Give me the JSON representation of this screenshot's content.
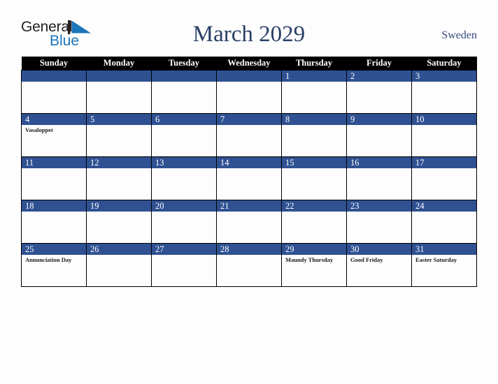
{
  "brand": {
    "name_part1": "General",
    "name_part2": "Blue",
    "mark_icon": "triangle-flag-icon",
    "color_dark": "#231f20",
    "color_blue": "#1b75bb"
  },
  "header": {
    "title": "March 2029",
    "country": "Sweden"
  },
  "colors": {
    "header_row_bg": "#000000",
    "day_band_bg": "#2f5192",
    "title_text": "#2b3f66",
    "country_text": "#34497a",
    "page_bg": "#fdfdfd",
    "grid_border": "#000000"
  },
  "calendar": {
    "weekday_headers": [
      "Sunday",
      "Monday",
      "Tuesday",
      "Wednesday",
      "Thursday",
      "Friday",
      "Saturday"
    ],
    "weeks": [
      [
        {
          "date": "",
          "events": []
        },
        {
          "date": "",
          "events": []
        },
        {
          "date": "",
          "events": []
        },
        {
          "date": "",
          "events": []
        },
        {
          "date": "1",
          "events": []
        },
        {
          "date": "2",
          "events": []
        },
        {
          "date": "3",
          "events": []
        }
      ],
      [
        {
          "date": "4",
          "events": [
            "Vasaloppet"
          ]
        },
        {
          "date": "5",
          "events": []
        },
        {
          "date": "6",
          "events": []
        },
        {
          "date": "7",
          "events": []
        },
        {
          "date": "8",
          "events": []
        },
        {
          "date": "9",
          "events": []
        },
        {
          "date": "10",
          "events": []
        }
      ],
      [
        {
          "date": "11",
          "events": []
        },
        {
          "date": "12",
          "events": []
        },
        {
          "date": "13",
          "events": []
        },
        {
          "date": "14",
          "events": []
        },
        {
          "date": "15",
          "events": []
        },
        {
          "date": "16",
          "events": []
        },
        {
          "date": "17",
          "events": []
        }
      ],
      [
        {
          "date": "18",
          "events": []
        },
        {
          "date": "19",
          "events": []
        },
        {
          "date": "20",
          "events": []
        },
        {
          "date": "21",
          "events": []
        },
        {
          "date": "22",
          "events": []
        },
        {
          "date": "23",
          "events": []
        },
        {
          "date": "24",
          "events": []
        }
      ],
      [
        {
          "date": "25",
          "events": [
            "Annunciation Day"
          ]
        },
        {
          "date": "26",
          "events": []
        },
        {
          "date": "27",
          "events": []
        },
        {
          "date": "28",
          "events": []
        },
        {
          "date": "29",
          "events": [
            "Maundy Thursday"
          ]
        },
        {
          "date": "30",
          "events": [
            "Good Friday"
          ]
        },
        {
          "date": "31",
          "events": [
            "Easter Saturday"
          ]
        }
      ]
    ]
  }
}
